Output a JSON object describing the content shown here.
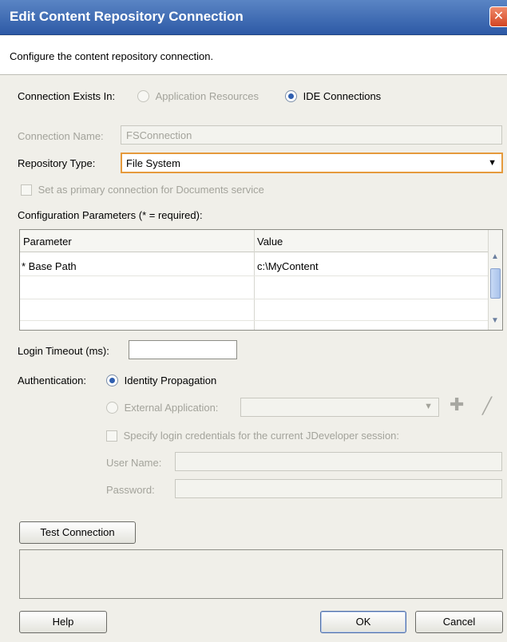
{
  "dialog": {
    "title": "Edit Content Repository Connection",
    "subtitle": "Configure the content repository connection."
  },
  "connection_exists": {
    "label": "Connection Exists In:",
    "options": [
      {
        "label": "Application Resources",
        "selected": false,
        "enabled": false
      },
      {
        "label": "IDE Connections",
        "selected": true,
        "enabled": true
      }
    ]
  },
  "connection_name": {
    "label": "Connection Name:",
    "value": "FSConnection"
  },
  "repository_type": {
    "label": "Repository Type:",
    "value": "File System"
  },
  "primary_connection": {
    "label": "Set as primary connection for Documents service",
    "checked": false
  },
  "config_params": {
    "label": "Configuration Parameters (* = required):",
    "columns": [
      "Parameter",
      "Value"
    ],
    "rows": [
      {
        "parameter": "* Base Path",
        "value": "c:\\MyContent"
      }
    ]
  },
  "login_timeout": {
    "label": "Login Timeout (ms):",
    "value": ""
  },
  "authentication": {
    "label": "Authentication:",
    "identity_propagation": "Identity Propagation",
    "external_application": "External Application:",
    "specify_credentials": "Specify login credentials for the current JDeveloper session:",
    "user_name_label": "User Name:",
    "password_label": "Password:"
  },
  "buttons": {
    "test_connection": "Test Connection",
    "help": "Help",
    "ok": "OK",
    "cancel": "Cancel"
  },
  "icons": {
    "add": "plus-icon",
    "edit": "pencil-icon",
    "close": "close-icon"
  },
  "colors": {
    "titlebar": "#2d5aa6",
    "focus_border": "#e59a3c",
    "disabled_text": "#a3a39b"
  }
}
